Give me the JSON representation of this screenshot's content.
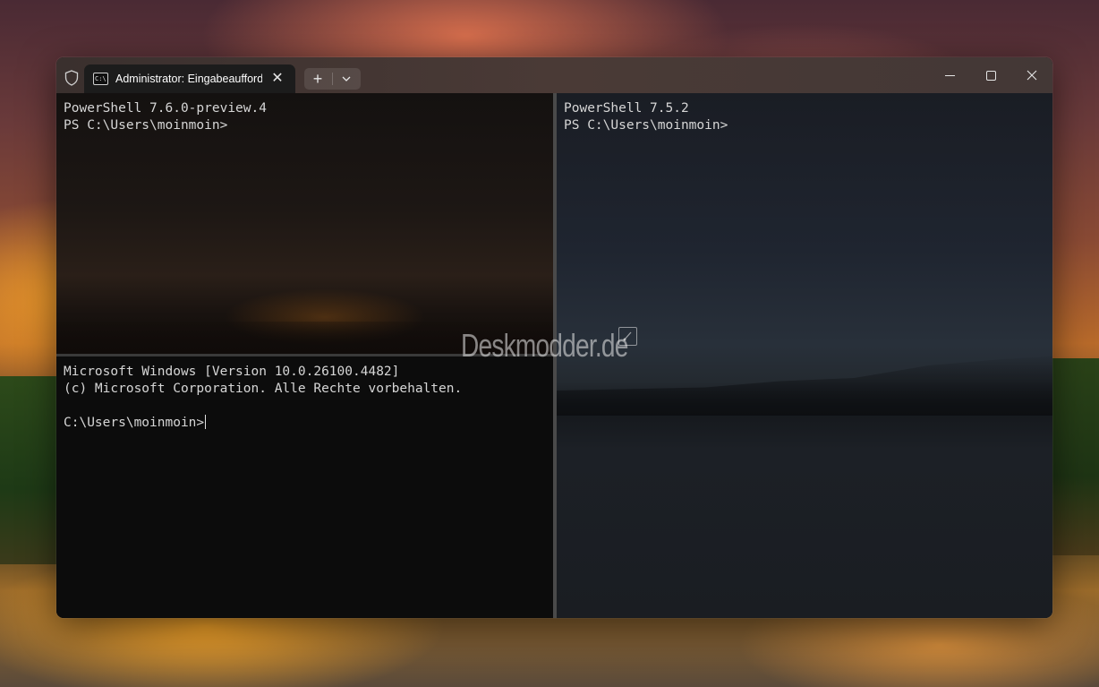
{
  "window": {
    "tab_title": "Administrator: Eingabeaufforderung",
    "tab_icon_text": "C:\\",
    "tab_close": "✕",
    "new_tab_label": "+"
  },
  "panes": {
    "top_left": {
      "lines": [
        "PowerShell 7.6.0-preview.4",
        "PS C:\\Users\\moinmoin>"
      ]
    },
    "bottom_left": {
      "lines": [
        "Microsoft Windows [Version 10.0.26100.4482]",
        "(c) Microsoft Corporation. Alle Rechte vorbehalten.",
        "",
        "C:\\Users\\moinmoin>"
      ]
    },
    "right": {
      "lines": [
        "PowerShell 7.5.2",
        "PS C:\\Users\\moinmoin>"
      ]
    }
  },
  "watermark": {
    "text": "Deskmodder.de"
  },
  "icons": {
    "shield": "shield-icon",
    "tab": "terminal-icon",
    "dropdown": "chevron-down-icon",
    "minimize": "minimize-icon",
    "maximize": "maximize-icon",
    "close": "close-icon"
  }
}
